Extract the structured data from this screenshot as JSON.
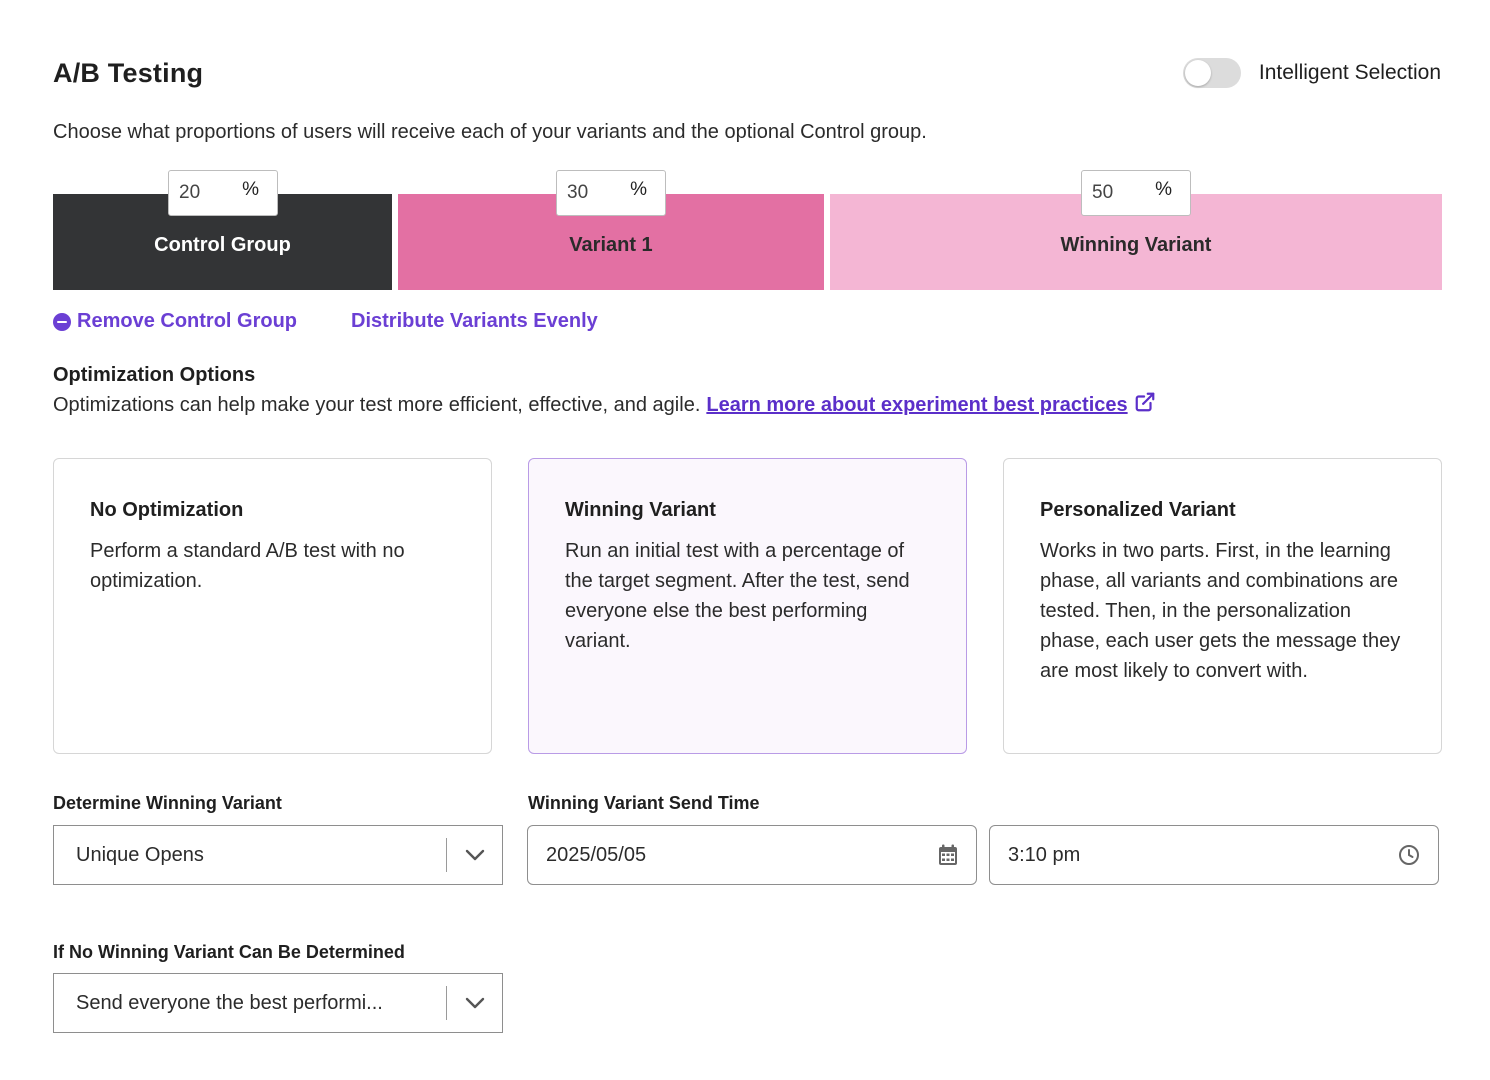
{
  "header": {
    "title": "A/B Testing",
    "toggle_label": "Intelligent Selection",
    "toggle_on": false,
    "description": "Choose what proportions of users will receive each of your variants and the optional Control group."
  },
  "distribution": [
    {
      "name": "Control Group",
      "percent": "20",
      "symbol": "%",
      "color": "#333436"
    },
    {
      "name": "Variant 1",
      "percent": "30",
      "symbol": "%",
      "color": "#e370a3"
    },
    {
      "name": "Winning Variant",
      "percent": "50",
      "symbol": "%",
      "color": "#f4b6d4"
    }
  ],
  "actions": {
    "remove_control": "Remove Control Group",
    "distribute_evenly": "Distribute Variants Evenly"
  },
  "optimization": {
    "title": "Optimization Options",
    "description": "Optimizations can help make your test more efficient, effective, and agile.",
    "link_text": "Learn more about experiment best practices",
    "cards": [
      {
        "title": "No Optimization",
        "body": "Perform a standard A/B test with no optimization.",
        "selected": false
      },
      {
        "title": "Winning Variant",
        "body": "Run an initial test with a percentage of the target segment. After the test, send everyone else the best performing variant.",
        "selected": true
      },
      {
        "title": "Personalized Variant",
        "body": "Works in two parts. First, in the learning phase, all variants and combinations are tested. Then, in the personalization phase, each user gets the message they are most likely to convert with.",
        "selected": false
      }
    ]
  },
  "determine": {
    "label": "Determine Winning Variant",
    "value": "Unique Opens"
  },
  "send_time": {
    "label": "Winning Variant Send Time",
    "date": "2025/05/05",
    "time": "3:10 pm"
  },
  "fallback": {
    "label": "If No Winning Variant Can Be Determined",
    "value": "Send everyone the best performi..."
  },
  "colors": {
    "accent": "#6b3fd4",
    "selected_card_bg": "#fbf7fd",
    "selected_card_border": "#b99be6"
  }
}
